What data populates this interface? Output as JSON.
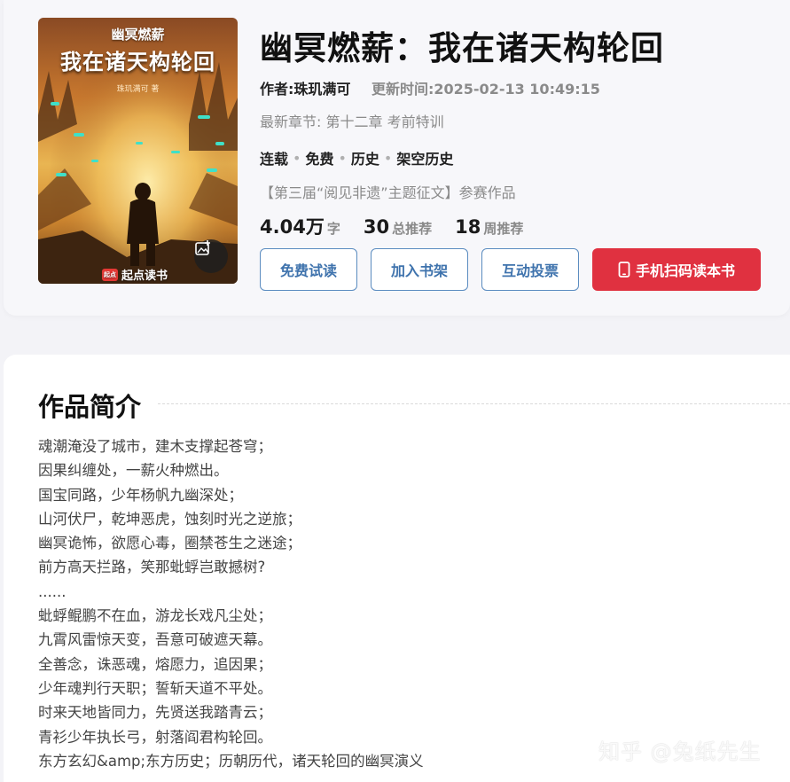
{
  "cover": {
    "series_text": "幽冥燃薪",
    "title_text": "我在诸天构轮回",
    "author_text": "珠玑满可 著",
    "publisher": "起点读书",
    "publisher_logo": "起点",
    "camera_icon": "image-search-icon"
  },
  "book": {
    "title": "幽冥燃薪：我在诸天构轮回",
    "author": "作者:珠玑满可",
    "updated": "更新时间:2025-02-13 10:49:15",
    "latest_chapter": "最新章节: 第十二章 考前特训",
    "tags": [
      "连载",
      "免费",
      "历史",
      "架空历史"
    ],
    "contest": "【第三届“阅见非遗”主题征文】参赛作品",
    "stats": [
      {
        "num": "4.04万",
        "unit": "字"
      },
      {
        "num": "30",
        "unit": "总推荐"
      },
      {
        "num": "18",
        "unit": "周推荐"
      }
    ]
  },
  "buttons": {
    "free_trial": "免费试读",
    "add_shelf": "加入书架",
    "vote": "互动投票",
    "scan_read": "手机扫码读本书"
  },
  "intro": {
    "heading": "作品简介",
    "lines": [
      "魂潮淹没了城市，建木支撑起苍穹；",
      "因果纠缠处，一薪火种燃出。",
      "国宝同路，少年杨帆九幽深处；",
      "山河伏尸，乾坤恶虎，蚀刻时光之逆旅；",
      "幽冥诡怖，欲愿心毒，圈禁苍生之迷途；",
      "前方高天拦路，笑那蚍蜉岂敢撼树?",
      "......",
      "蚍蜉鲲鹏不在血，游龙长戏凡尘处；",
      "九霄风雷惊天变，吾意可破遮天幕。",
      "全善念，诛恶魂，熔愿力，追因果；",
      "少年魂判行天职；誓斩天道不平处。",
      "时来天地皆同力，先贤送我踏青云；",
      "青衫少年执长弓，射落阎君构轮回。",
      "东方玄幻&amp;东方历史；历朝历代，诸天轮回的幽冥演义"
    ]
  },
  "watermark": "知乎 @兔纸先生",
  "colors": {
    "accent_blue": "#3f73ad",
    "accent_red": "#e03140",
    "muted": "#8a8a8a"
  }
}
